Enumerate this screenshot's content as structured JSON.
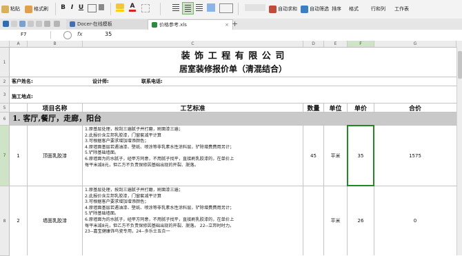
{
  "ribbon": {
    "paste": "粘贴",
    "format_painter": "格式刷",
    "bold": "B",
    "italic": "I",
    "underline": "U",
    "font_color": "A",
    "autosum": "自动求和",
    "autofilter": "自动筛选",
    "sort": "排序",
    "format": "格式",
    "rowcol": "行和列",
    "worksheet": "工作表"
  },
  "tabs": [
    {
      "label": "Docer-在线模板",
      "icon": "docer-icon"
    },
    {
      "label": "价格参考.xls",
      "icon": "excel-file-icon"
    }
  ],
  "formula_bar": {
    "name_box": "F7",
    "fx": "fx",
    "value": "35"
  },
  "columns": [
    "A",
    "B",
    "C",
    "D",
    "E",
    "F",
    "G"
  ],
  "rows": [
    "1",
    "2",
    "3",
    "5",
    "6",
    "7",
    "8"
  ],
  "sheet": {
    "company": "装 饰 工 程 有 限 公 司",
    "subtitle": "居室装修报价单（清混结合）",
    "client_label": "客户姓名:",
    "designer_label": "设计师:",
    "phone_label": "联系电话:",
    "address_label": "施工地点:",
    "headers": {
      "item": "项目名称",
      "standard": "工艺标准",
      "qty": "数量",
      "unit": "单位",
      "price": "单价",
      "total": "合价"
    },
    "section": "1. 客厅,餐厅，走廊，阳台",
    "items": [
      {
        "no": "1",
        "name": "顶面乳胶漆",
        "standard": [
          "1.原基层处理，按刮三遍腻子并打磨，刷面漆三遍；",
          "2.此报价含立邦乳胶漆，门窗套减平计算",
          "3.可根据客户要求增加增添颜色；",
          "4.原墙面基层若遇油漆、壁纸、喷涂等非乳素水性涂料层，铲除增费费用另计；",
          "5.铲除基础墙面。",
          "6.原墙面为的水腻子，经甲方同意，不用腻子找平，直接刷乳胶漆的，在单价上",
          "每平米减8元，但乙方不负责保修因基础出现的开裂、脱落。"
        ],
        "qty": "45",
        "unit": "平米",
        "price": "35",
        "total": "1575"
      },
      {
        "no": "2",
        "name": "墙面乳胶漆",
        "standard": [
          "1.原基层处理，按刮三遍腻子并打磨，刷面漆三遍；",
          "2.此报价含立邦乳胶漆，门窗套减平计算",
          "3.可根据客户要求增加增添颜色；",
          "4.原墙面基层若遇油漆、壁纸、喷涂等非乳素水性涂料层，铲除增费费用另计；",
          "5.铲除基础墙面。",
          "6.原墙面为的水腻子，经甲方同意，不用腻子找平，直接刷乳胶漆的，在单价上",
          "每平米减8元，但乙方不负责保修因基础出现的开裂、脱落。 22--立邦时时力。",
          "23--嘉宝健康饰鸟瓷专用，24--多乐士五合一"
        ],
        "qty": "",
        "unit": "平米",
        "price": "26",
        "total": "0"
      }
    ]
  },
  "colors": {
    "section_bg": "#c9c9c9",
    "selected_border": "#1f8a1f",
    "selected_header": "#cfe4c6"
  }
}
